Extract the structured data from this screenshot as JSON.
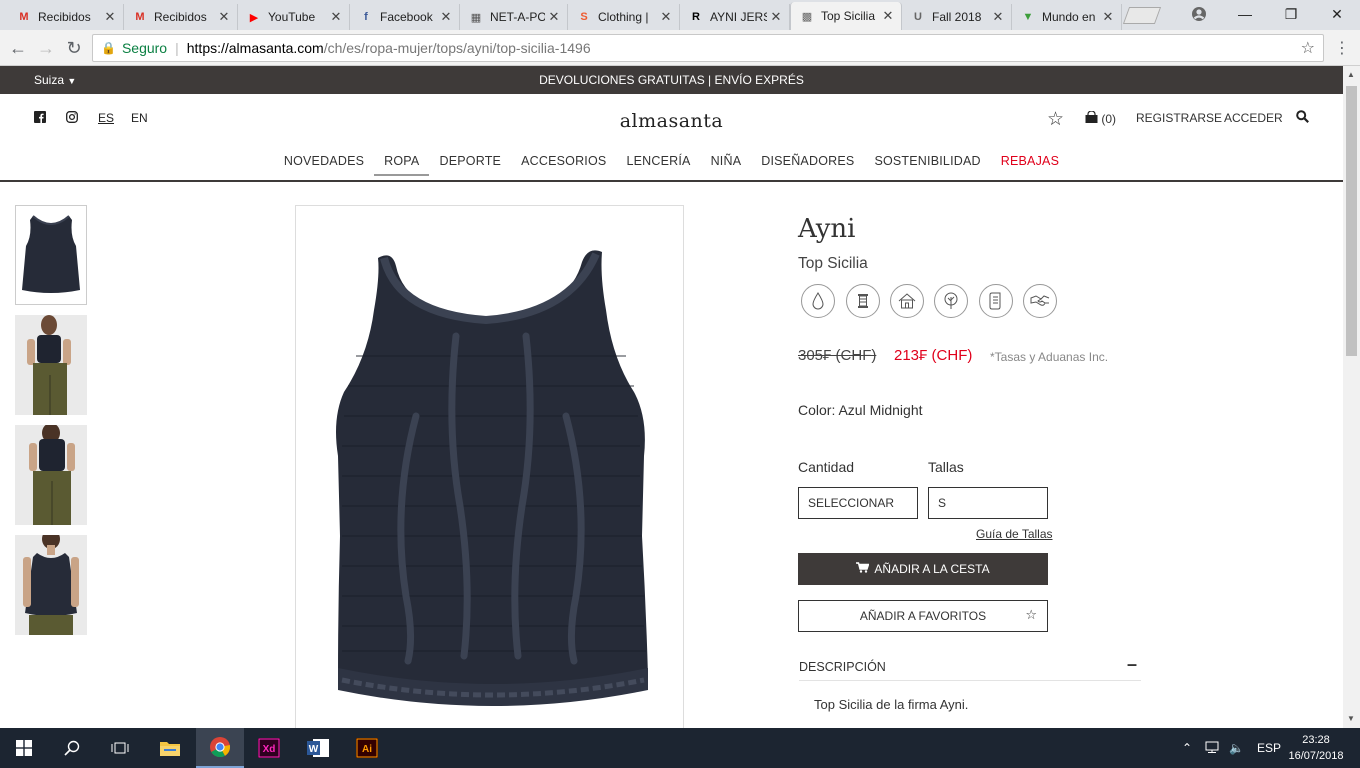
{
  "browser": {
    "tabs": [
      {
        "title": "Recibidos",
        "icon": "gmail-icon",
        "glyph": "M",
        "color": "#d93025"
      },
      {
        "title": "Recibidos",
        "icon": "gmail-icon",
        "glyph": "M",
        "color": "#d93025"
      },
      {
        "title": "YouTube",
        "icon": "youtube-icon",
        "glyph": "▶",
        "color": "#ff0000"
      },
      {
        "title": "Facebook",
        "icon": "facebook-icon",
        "glyph": "f",
        "color": "#3b5998"
      },
      {
        "title": "NET-A-PO",
        "icon": "netaporter-icon",
        "glyph": "▦",
        "color": "#555555"
      },
      {
        "title": "Clothing |",
        "icon": "shopstyle-icon",
        "glyph": "S",
        "color": "#ee5a2f"
      },
      {
        "title": "AYNI JERS",
        "icon": "r-icon",
        "glyph": "R",
        "color": "#000000"
      },
      {
        "title": "Top Sicilia",
        "icon": "almasanta-icon",
        "glyph": "▩",
        "color": "#666666"
      },
      {
        "title": "Fall 2018",
        "icon": "u-icon",
        "glyph": "U",
        "color": "#666666"
      },
      {
        "title": "Mundo en",
        "icon": "v-icon",
        "glyph": "▼",
        "color": "#3c9d3a"
      }
    ],
    "address": {
      "secure_label": "Seguro",
      "host": "https://almasanta.com",
      "path": "/ch/es/ropa-mujer/tops/ayni/top-sicilia-1496"
    }
  },
  "site": {
    "promo": {
      "country": "Suiza",
      "message": "DEVOLUCIONES GRATUITAS | ENVÍO EXPRÉS"
    },
    "header": {
      "lang_es": "ES",
      "lang_en": "EN",
      "logo": "almasanta",
      "cart_count": "(0)",
      "register": "REGISTRARSE",
      "login": "ACCEDER"
    },
    "nav": [
      {
        "label": "NOVEDADES",
        "slug": "novedades"
      },
      {
        "label": "ROPA",
        "slug": "ropa"
      },
      {
        "label": "DEPORTE",
        "slug": "deporte"
      },
      {
        "label": "ACCESORIOS",
        "slug": "accesorios"
      },
      {
        "label": "LENCERÍA",
        "slug": "lenceria"
      },
      {
        "label": "NIÑA",
        "slug": "nina"
      },
      {
        "label": "DISEÑADORES",
        "slug": "disenadores"
      },
      {
        "label": "SOSTENIBILIDAD",
        "slug": "sostenibilidad"
      },
      {
        "label": "REBAJAS",
        "slug": "rebajas"
      }
    ],
    "nav_active": "ROPA",
    "sale_color": "#e0001b"
  },
  "product": {
    "brand": "Ayni",
    "name": "Top Sicilia",
    "attributes": [
      "water-drop-icon",
      "thread-spool-icon",
      "house-icon",
      "tree-icon",
      "scroll-icon",
      "handshake-icon"
    ],
    "price_old": "305₣ (CHF)",
    "price_new": "213₣ (CHF)",
    "tax_note": "*Tasas y Aduanas Inc.",
    "color_label": "Color: Azul Midnight",
    "quantity_label": "Cantidad",
    "quantity_value": "SELECCIONAR",
    "size_label": "Tallas",
    "size_value": "S",
    "size_guide": "Guía de Tallas",
    "add_to_cart": "AÑADIR A LA CESTA",
    "add_to_favorites": "AÑADIR A FAVORITOS",
    "description_heading": "DESCRIPCIÓN",
    "description_text": "Top Sicilia de la firma Ayni.",
    "garment_color": "#262b38"
  },
  "taskbar": {
    "lang": "ESP",
    "time": "23:28",
    "date": "16/07/2018"
  }
}
